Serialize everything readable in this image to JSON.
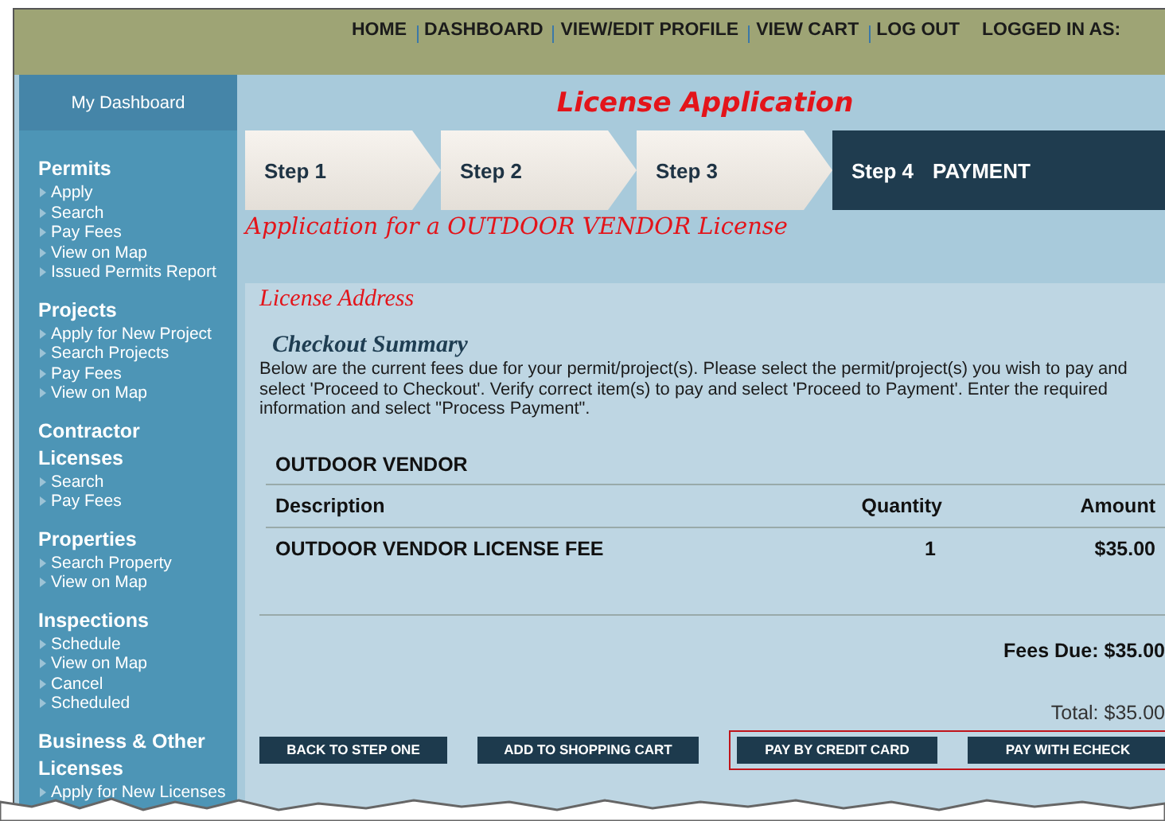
{
  "top_nav": {
    "links": [
      "HOME",
      "DASHBOARD",
      "VIEW/EDIT PROFILE",
      "VIEW CART",
      "LOG OUT"
    ],
    "logged_in_label": "LOGGED IN AS:"
  },
  "sidebar": {
    "dashboard": "My Dashboard",
    "groups": [
      {
        "title": "Permits",
        "items": [
          "Apply",
          "Search",
          "Pay Fees",
          "View on Map",
          "Issued Permits Report"
        ]
      },
      {
        "title": "Projects",
        "items": [
          "Apply for New Project",
          "Search Projects",
          "Pay Fees",
          "View on Map"
        ]
      },
      {
        "title": "Contractor Licenses",
        "items": [
          "Search",
          "Pay Fees"
        ]
      },
      {
        "title": "Properties",
        "items": [
          "Search Property",
          "View on Map"
        ]
      },
      {
        "title": "Inspections",
        "items": [
          "Schedule",
          "View on Map",
          "Cancel",
          "Scheduled"
        ]
      },
      {
        "title": "Business & Other Licenses",
        "items": [
          "Apply for New Licenses"
        ]
      }
    ]
  },
  "page_title": "License Application",
  "steps": [
    {
      "label": "Step 1",
      "selected": false
    },
    {
      "label": "Step 2",
      "selected": false
    },
    {
      "label": "Step 3",
      "selected": false
    },
    {
      "label": "Step 4",
      "caption": "PAYMENT",
      "selected": true
    }
  ],
  "application_title": "Application for a OUTDOOR VENDOR License",
  "section_title": "License Address",
  "checkout": {
    "title": "Checkout Summary",
    "instructions": "Below are the current fees due for your permit/project(s). Please select the permit/project(s) you wish to pay and select 'Proceed to Checkout'. Verify correct item(s) to pay and select 'Proceed to Payment'. Enter the required information and select \"Process Payment\"."
  },
  "table": {
    "group": "OUTDOOR VENDOR",
    "columns": [
      "Description",
      "Quantity",
      "Amount"
    ],
    "rows": [
      [
        "OUTDOOR VENDOR LICENSE FEE",
        "1",
        "$35.00"
      ]
    ]
  },
  "fees_due": "Fees Due: $35.00",
  "total": "Total: $35.00",
  "buttons": [
    "BACK TO STEP ONE",
    "ADD TO SHOPPING CART"
  ],
  "highlighted_buttons": [
    "PAY BY CREDIT CARD",
    "PAY WITH ECHECK"
  ]
}
